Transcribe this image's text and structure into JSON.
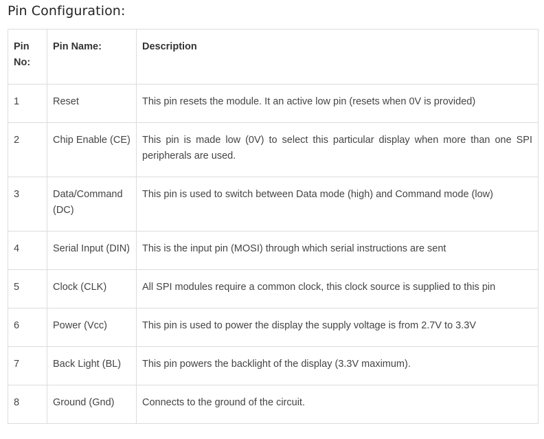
{
  "title": "Pin Configuration:",
  "table": {
    "headers": {
      "pin_no": "Pin No:",
      "pin_name": "Pin Name:",
      "description": "Description"
    },
    "rows": [
      {
        "pin_no": "1",
        "pin_name": "Reset",
        "description": "This pin resets the module. It an active low pin (resets when 0V is provided)"
      },
      {
        "pin_no": "2",
        "pin_name": "Chip Enable (CE)",
        "description": "This pin is made low (0V) to select this particular display when more than one SPI peripherals are used."
      },
      {
        "pin_no": "3",
        "pin_name": "Data/Command (DC)",
        "description": "This pin is used to switch between Data mode (high) and Command mode (low)"
      },
      {
        "pin_no": "4",
        "pin_name": "Serial Input (DIN)",
        "description": "This is the input pin (MOSI) through which serial instructions are sent"
      },
      {
        "pin_no": "5",
        "pin_name": "Clock (CLK)",
        "description": "All SPI modules require a common clock, this clock source is supplied to this pin"
      },
      {
        "pin_no": "6",
        "pin_name": "Power (Vcc)",
        "description": "This pin is used to power the display the supply voltage is from 2.7V to 3.3V"
      },
      {
        "pin_no": "7",
        "pin_name": "Back Light (BL)",
        "description": "This pin powers the backlight of the display (3.3V maximum)."
      },
      {
        "pin_no": "8",
        "pin_name": "Ground (Gnd)",
        "description": "Connects to the ground of the circuit."
      }
    ]
  }
}
